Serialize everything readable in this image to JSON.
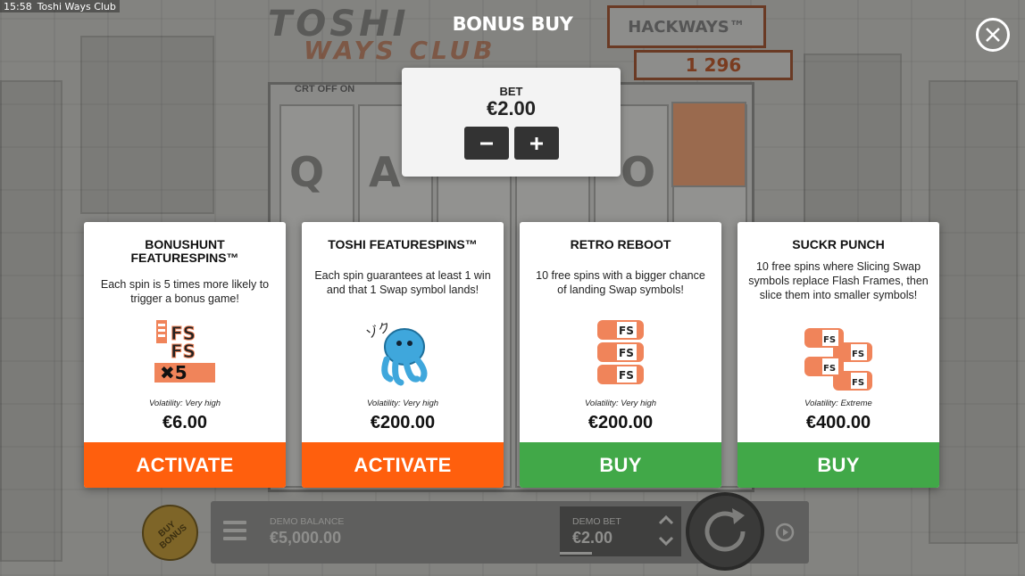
{
  "os_bar": {
    "time": "15:58",
    "window_title": "Toshi Ways Club"
  },
  "background": {
    "logo_line1": "TOSHI",
    "logo_line2": "WAYS CLUB",
    "hackways_label": "HACKWAYS™",
    "hackways_value": "1 296",
    "crt_toggle": "CRT OFF ON",
    "reel_letters": [
      "Q",
      "A",
      "O"
    ]
  },
  "modal": {
    "title": "BONUS BUY",
    "close_icon": "close-icon",
    "bet": {
      "label": "BET",
      "value": "€2.00",
      "minus_icon": "minus-icon",
      "plus_icon": "plus-icon"
    }
  },
  "offers": [
    {
      "title": "BONUSHUNT FEATURESPINS™",
      "description": "Each spin is 5 times more likely to trigger a bonus game!",
      "icon": "fs-x5-icon",
      "volatility": "Volatility: Very high",
      "price": "€6.00",
      "action": "ACTIVATE",
      "action_color": "#ff5f0d"
    },
    {
      "title": "TOSHI FEATURESPINS™",
      "description": "Each spin guarantees at least 1 win and that 1 Swap symbol lands!",
      "icon": "octopus-icon",
      "volatility": "Volatility: Very high",
      "price": "€200.00",
      "action": "ACTIVATE",
      "action_color": "#ff5f0d"
    },
    {
      "title": "RETRO REBOOT",
      "description": "10 free spins with a bigger chance of landing Swap symbols!",
      "icon": "stacked-fs-icon",
      "volatility": "Volatility: Very high",
      "price": "€200.00",
      "action": "BUY",
      "action_color": "#41a848"
    },
    {
      "title": "SUCKR PUNCH",
      "description": "10 free spins where Slicing Swap symbols replace Flash Frames, then slice them into smaller symbols!",
      "icon": "sliced-fs-icon",
      "volatility": "Volatility: Extreme",
      "price": "€400.00",
      "action": "BUY",
      "action_color": "#41a848"
    }
  ],
  "controls": {
    "buy_bonus_label": "BUY BONUS",
    "balance_label": "DEMO BALANCE",
    "balance_value": "€5,000.00",
    "bet_label": "DEMO BET",
    "bet_value": "€2.00",
    "menu_icon": "hamburger-menu-icon",
    "spin_icon": "spin-arrow-icon",
    "autoplay_icon": "autoplay-icon"
  },
  "colors": {
    "activate": "#ff5f0d",
    "buy": "#41a848",
    "panel": "#f3f3f3",
    "icon_orange": "#f0845a",
    "octopus_blue": "#3fa7dc"
  }
}
